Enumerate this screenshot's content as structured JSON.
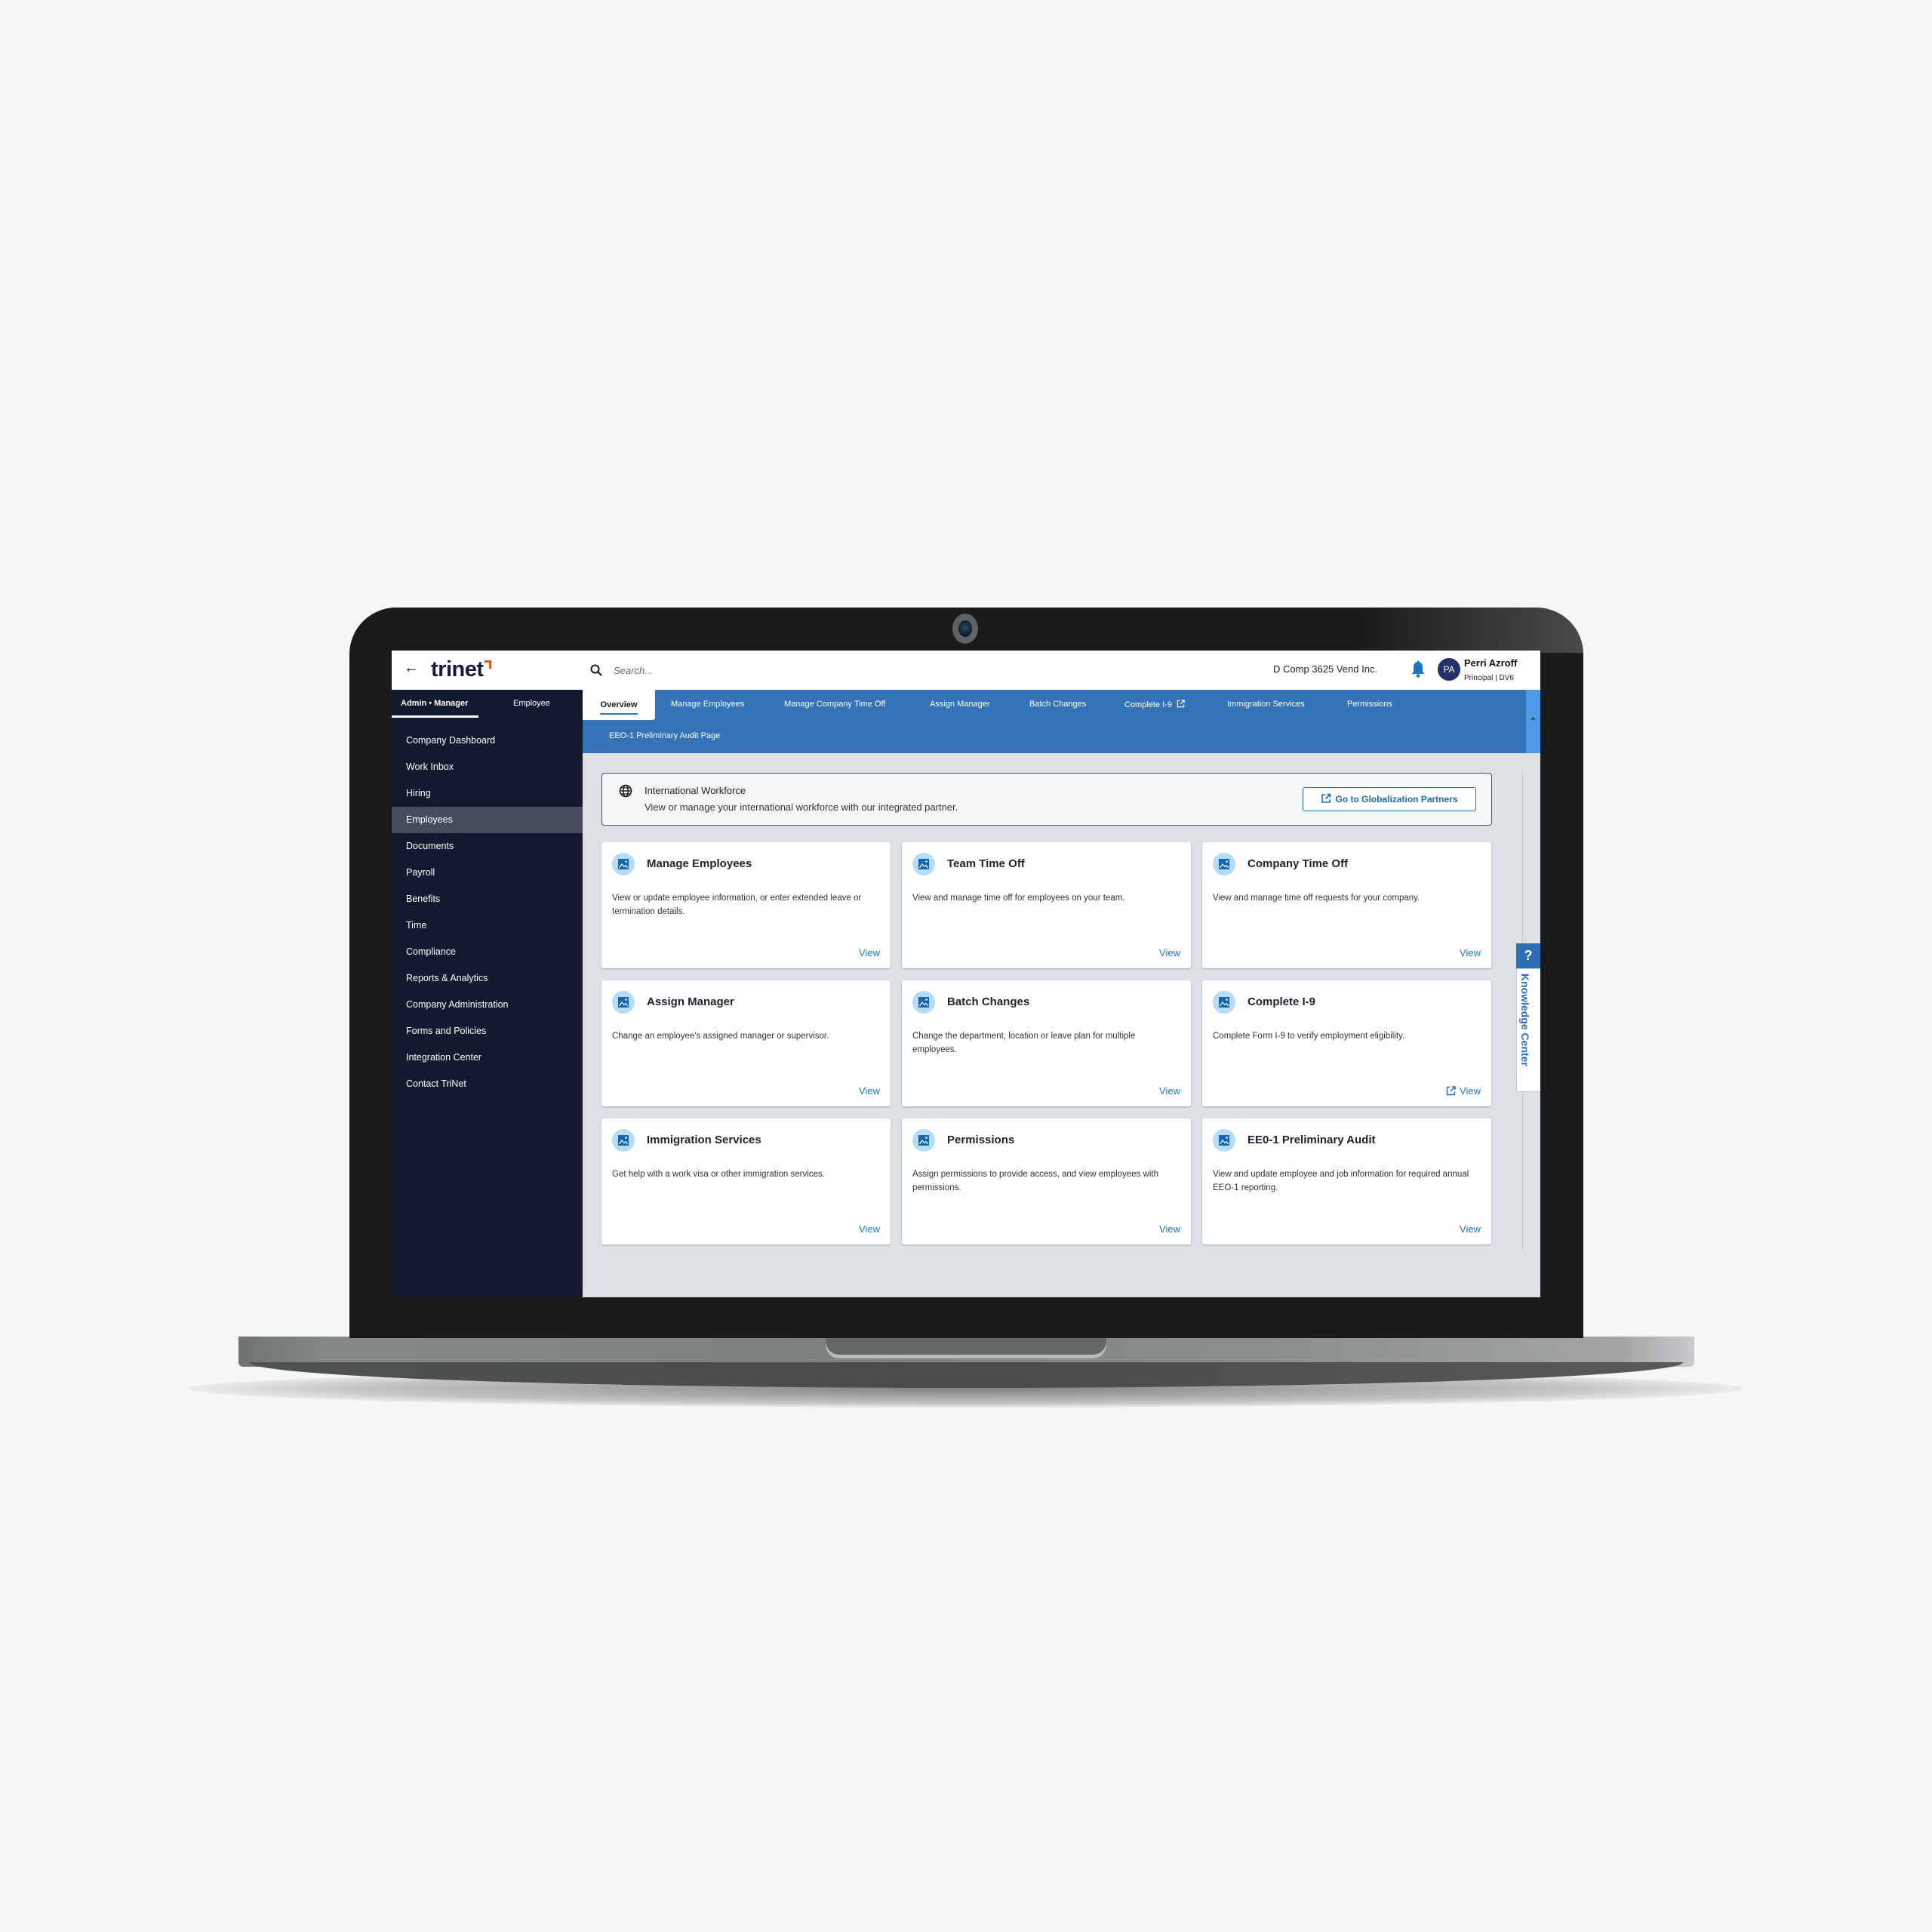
{
  "header": {
    "back_label": "←",
    "brand": "trinet",
    "search_placeholder": "Search...",
    "company": "D Comp 3625 Vend Inc.",
    "user_initials": "PA",
    "user_name": "Perri Azroff",
    "user_role": "Principal | DV6"
  },
  "sidebar": {
    "role_tabs": [
      {
        "label": "Admin • Manager",
        "active": true
      },
      {
        "label": "Employee",
        "active": false
      }
    ],
    "items": [
      {
        "label": "Company Dashboard"
      },
      {
        "label": "Work Inbox"
      },
      {
        "label": "Hiring"
      },
      {
        "label": "Employees",
        "active": true
      },
      {
        "label": "Documents"
      },
      {
        "label": "Payroll"
      },
      {
        "label": "Benefits"
      },
      {
        "label": "Time"
      },
      {
        "label": "Compliance"
      },
      {
        "label": "Reports & Analytics"
      },
      {
        "label": "Company Administration"
      },
      {
        "label": "Forms and Policies"
      },
      {
        "label": "Integration Center"
      },
      {
        "label": "Contact TriNet"
      }
    ]
  },
  "tabs": [
    {
      "label": "Overview",
      "active": true
    },
    {
      "label": "Manage Employees"
    },
    {
      "label": "Manage Company Time Off"
    },
    {
      "label": "Assign Manager"
    },
    {
      "label": "Batch Changes"
    },
    {
      "label": "Complete I-9",
      "external": true
    },
    {
      "label": "Immigration Services"
    },
    {
      "label": "Permissions"
    },
    {
      "label": "EEO-1 Preliminary Audit Page"
    }
  ],
  "collapse_icon": "chevron-up",
  "banner": {
    "title": "International Workforce",
    "description": "View or manage your international workforce with our integrated partner.",
    "button_label": "Go to Globalization Partners"
  },
  "cards": [
    {
      "title": "Manage Employees",
      "description": "View or update employee information, or enter extended leave or termination details.",
      "link": "View"
    },
    {
      "title": "Team Time Off",
      "description": "View and manage time off for employees on your team.",
      "link": "View"
    },
    {
      "title": "Company Time Off",
      "description": "View and manage time off requests for your company.",
      "link": "View"
    },
    {
      "title": "Assign Manager",
      "description": "Change an employee's assigned manager or supervisor.",
      "link": "View"
    },
    {
      "title": "Batch Changes",
      "description": "Change the department, location or leave plan for multiple employees.",
      "link": "View"
    },
    {
      "title": "Complete I-9",
      "description": "Complete Form I-9 to verify employment eligibility.",
      "link": "View",
      "external": true
    },
    {
      "title": "Immigration Services",
      "description": "Get help with a work visa or other immigration services.",
      "link": "View"
    },
    {
      "title": "Permissions",
      "description": "Assign permissions to provide access, and view employees with permissions.",
      "link": "View"
    },
    {
      "title": "EE0-1 Preliminary Audit",
      "description": "View and update employee and job information for required annual EEO-1 reporting.",
      "link": "View"
    }
  ],
  "knowledge_center": {
    "icon_label": "?",
    "label": "Knowledge Center"
  },
  "colors": {
    "sidebar_bg": "#111a2e",
    "tabbar_bg": "#3573b8",
    "accent_link": "#1d74c1",
    "content_bg": "#dde1e6",
    "brand_accent": "#e45d25"
  }
}
